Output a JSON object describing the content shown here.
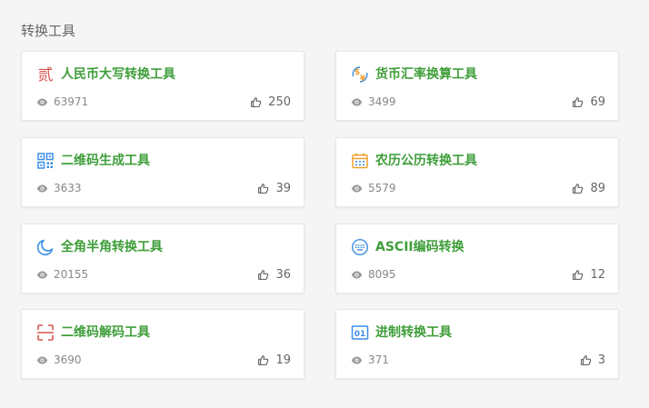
{
  "section": {
    "title": "转换工具"
  },
  "cards": [
    {
      "title": "人民币大写转换工具",
      "views": "63971",
      "likes": "250",
      "icon": "rmb-uppercase-icon"
    },
    {
      "title": "货币汇率换算工具",
      "views": "3499",
      "likes": "69",
      "icon": "currency-exchange-icon"
    },
    {
      "title": "二维码生成工具",
      "views": "3633",
      "likes": "39",
      "icon": "qrcode-icon"
    },
    {
      "title": "农历公历转换工具",
      "views": "5579",
      "likes": "89",
      "icon": "calendar-icon"
    },
    {
      "title": "全角半角转换工具",
      "views": "20155",
      "likes": "36",
      "icon": "moon-icon"
    },
    {
      "title": "ASCII编码转换",
      "views": "8095",
      "likes": "12",
      "icon": "keyboard-icon"
    },
    {
      "title": "二维码解码工具",
      "views": "3690",
      "likes": "19",
      "icon": "scan-icon"
    },
    {
      "title": "进制转换工具",
      "views": "371",
      "likes": "3",
      "icon": "binary-icon"
    }
  ],
  "colors": {
    "title_green": "#3f9e3a",
    "icon_red": "#d9534f",
    "icon_blue": "#3a8ee6",
    "icon_orange": "#f0a030"
  }
}
